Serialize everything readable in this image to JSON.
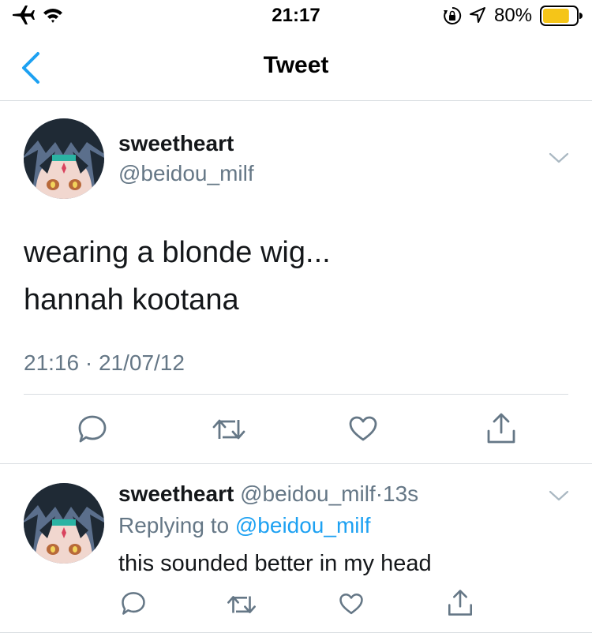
{
  "status_bar": {
    "time": "21:17",
    "battery_percent": "80%",
    "battery_level": 0.8,
    "battery_color": "#f5c518",
    "icons": [
      "airplane-icon",
      "wifi-icon",
      "orientation-lock-icon",
      "location-icon",
      "battery-icon"
    ]
  },
  "nav": {
    "title": "Tweet",
    "back_icon": "chevron-left-icon",
    "accent_color": "#1da1f2"
  },
  "main_tweet": {
    "display_name": "sweetheart",
    "handle": "@beidou_milf",
    "text_lines": [
      "wearing a blonde wig...",
      "hannah kootana"
    ],
    "timestamp": "21:16 · 21/07/12",
    "actions": [
      "reply-icon",
      "retweet-icon",
      "like-icon",
      "share-icon"
    ]
  },
  "reply_tweet": {
    "display_name": "sweetheart",
    "handle": "@beidou_milf",
    "separator": "·",
    "time": "13s",
    "replying_prefix": "Replying to ",
    "replying_mention": "@beidou_milf",
    "text": "this sounded better in my head",
    "actions": [
      "reply-icon",
      "retweet-icon",
      "like-icon",
      "share-icon"
    ]
  },
  "colors": {
    "text_primary": "#14171a",
    "text_secondary": "#657786",
    "link": "#1da1f2",
    "divider": "#d9dde1",
    "icon": "#657786"
  }
}
